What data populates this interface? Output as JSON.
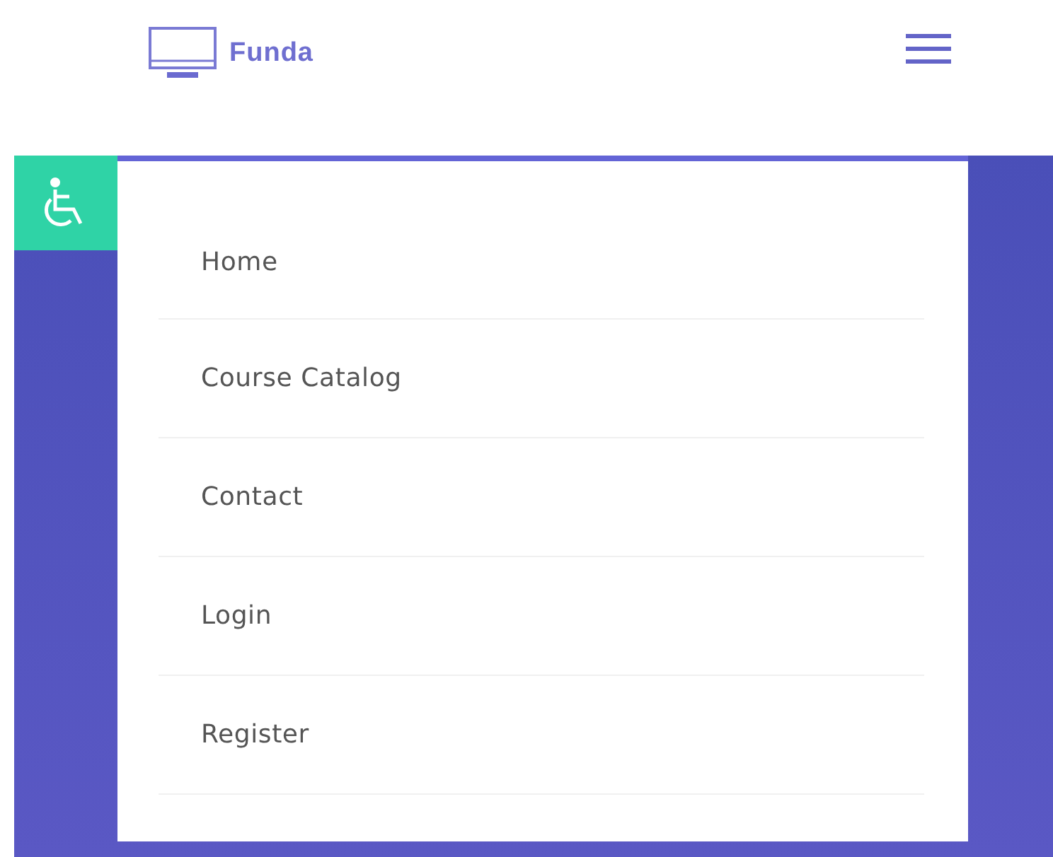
{
  "brand": {
    "name": "Funda"
  },
  "menu": {
    "expanded": true,
    "items": [
      {
        "label": "Home"
      },
      {
        "label": "Course Catalog"
      },
      {
        "label": "Contact"
      },
      {
        "label": "Login"
      },
      {
        "label": "Register"
      }
    ]
  }
}
